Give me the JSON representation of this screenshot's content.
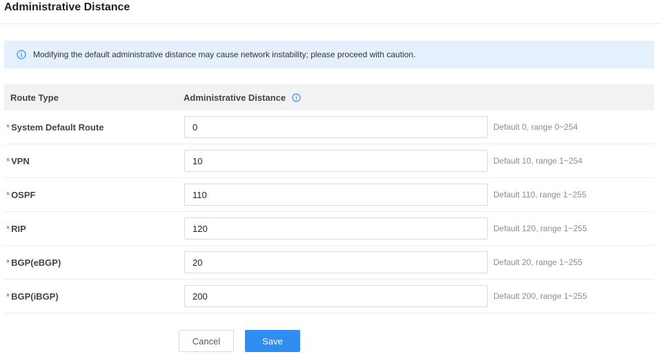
{
  "page": {
    "title": "Administrative Distance"
  },
  "notice": {
    "icon": "info-icon",
    "text": "Modifying the default administrative distance may cause network instability; please proceed with caution.",
    "background_color": "#e5f0fd",
    "icon_color": "#2f8cf0"
  },
  "table": {
    "headers": {
      "route_type": "Route Type",
      "admin_distance": "Administrative Distance"
    },
    "rows": [
      {
        "label": "System Default Route",
        "required_mark": "*",
        "value": "0",
        "hint": "Default 0, range 0~254"
      },
      {
        "label": "VPN",
        "required_mark": "*",
        "value": "10",
        "hint": "Default 10, range 1~254"
      },
      {
        "label": "OSPF",
        "required_mark": "*",
        "value": "110",
        "hint": "Default 110, range 1~255"
      },
      {
        "label": "RIP",
        "required_mark": "*",
        "value": "120",
        "hint": "Default 120, range 1~255"
      },
      {
        "label": "BGP(eBGP)",
        "required_mark": "*",
        "value": "20",
        "hint": "Default 20, range 1~255"
      },
      {
        "label": "BGP(iBGP)",
        "required_mark": "*",
        "value": "200",
        "hint": "Default 200, range 1~255"
      }
    ]
  },
  "actions": {
    "cancel_label": "Cancel",
    "save_label": "Save",
    "primary_color": "#2f8cf0"
  }
}
